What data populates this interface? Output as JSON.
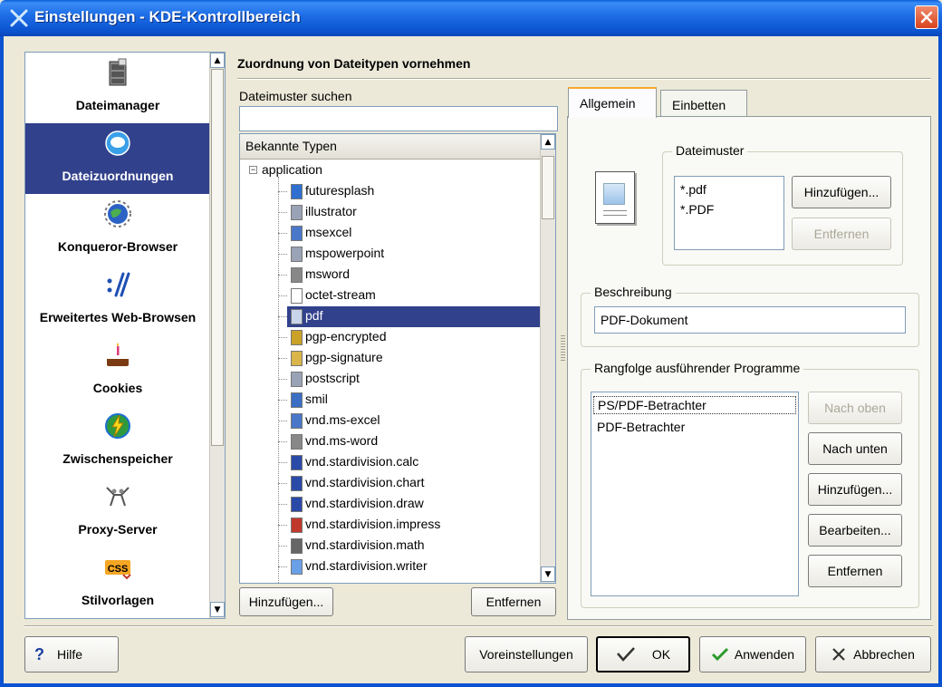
{
  "window": {
    "title": "Einstellungen - KDE-Kontrollbereich",
    "accent": "#0b53d0",
    "selection_color": "#31418c"
  },
  "sidebar": {
    "items": [
      {
        "label": "Dateimanager",
        "icon": "file-cabinet-icon"
      },
      {
        "label": "Dateizuordnungen",
        "icon": "globe-speech-icon"
      },
      {
        "label": "Konqueror-Browser",
        "icon": "world-gear-icon"
      },
      {
        "label": "Erweitertes Web-Browsen",
        "icon": "slash-arrows-icon"
      },
      {
        "label": "Cookies",
        "icon": "cake-icon"
      },
      {
        "label": "Zwischenspeicher",
        "icon": "lightning-globe-icon"
      },
      {
        "label": "Proxy-Server",
        "icon": "proxy-people-icon"
      },
      {
        "label": "Stilvorlagen",
        "icon": "css-icon"
      }
    ],
    "active_index": 1
  },
  "main": {
    "heading": "Zuordnung von Dateitypen vornehmen",
    "search_label": "Dateimuster suchen",
    "search_value": "",
    "tree": {
      "header": "Bekannte Typen",
      "root": "application",
      "items": [
        {
          "label": "futuresplash",
          "icon": "flash-icon"
        },
        {
          "label": "illustrator",
          "icon": "document-icon"
        },
        {
          "label": "msexcel",
          "icon": "spreadsheet-icon"
        },
        {
          "label": "mspowerpoint",
          "icon": "document-icon"
        },
        {
          "label": "msword",
          "icon": "pen-icon"
        },
        {
          "label": "octet-stream",
          "icon": "blank-file-icon"
        },
        {
          "label": "pdf",
          "icon": "pdf-icon"
        },
        {
          "label": "pgp-encrypted",
          "icon": "lock-icon"
        },
        {
          "label": "pgp-signature",
          "icon": "signature-icon"
        },
        {
          "label": "postscript",
          "icon": "document-icon"
        },
        {
          "label": "smil",
          "icon": "media-icon"
        },
        {
          "label": "vnd.ms-excel",
          "icon": "spreadsheet-icon"
        },
        {
          "label": "vnd.ms-word",
          "icon": "pen-icon"
        },
        {
          "label": "vnd.stardivision.calc",
          "icon": "calc-icon"
        },
        {
          "label": "vnd.stardivision.chart",
          "icon": "chart-icon"
        },
        {
          "label": "vnd.stardivision.draw",
          "icon": "draw-icon"
        },
        {
          "label": "vnd.stardivision.impress",
          "icon": "impress-icon"
        },
        {
          "label": "vnd.stardivision.math",
          "icon": "math-icon"
        },
        {
          "label": "vnd.stardivision.writer",
          "icon": "writer-icon"
        }
      ],
      "selected": "pdf"
    },
    "add_button": "Hinzufügen...",
    "remove_button": "Entfernen"
  },
  "tabs": [
    {
      "label": "Allgemein"
    },
    {
      "label": "Einbetten"
    }
  ],
  "general": {
    "patterns_title": "Dateimuster",
    "patterns": [
      "*.pdf",
      "*.PDF"
    ],
    "patterns_add": "Hinzufügen...",
    "patterns_remove": "Entfernen",
    "description_title": "Beschreibung",
    "description_value": "PDF-Dokument",
    "programs_title": "Rangfolge ausführender Programme",
    "programs": [
      "PS/PDF-Betrachter",
      "PDF-Betrachter"
    ],
    "btn_up": "Nach oben",
    "btn_down": "Nach unten",
    "btn_add": "Hinzufügen...",
    "btn_edit": "Bearbeiten...",
    "btn_remove": "Entfernen"
  },
  "footer": {
    "help": "Hilfe",
    "defaults": "Voreinstellungen",
    "ok": "OK",
    "apply": "Anwenden",
    "cancel": "Abbrechen"
  }
}
